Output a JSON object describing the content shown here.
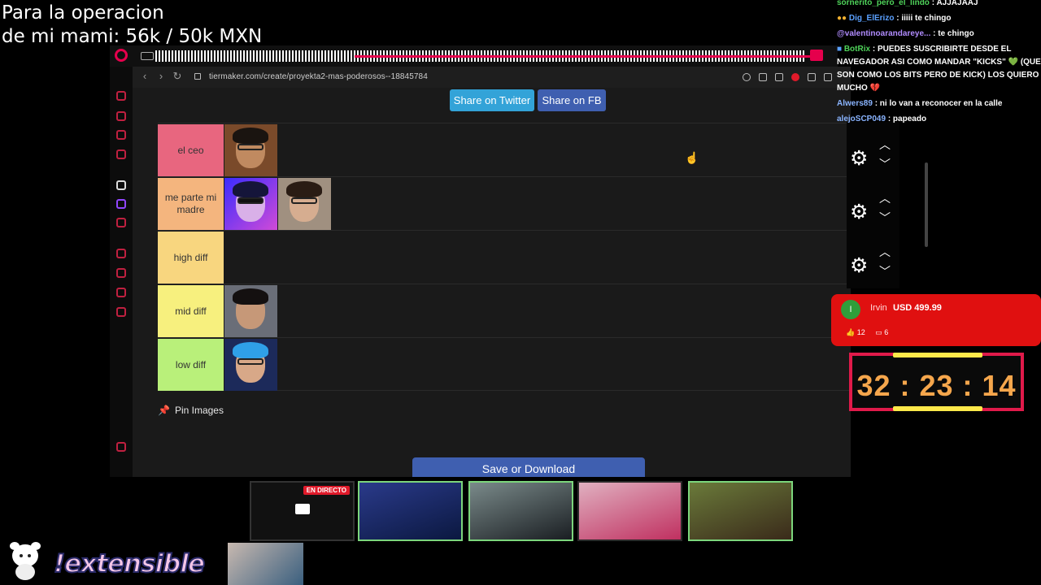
{
  "overlay": {
    "goal_line1": "Para la operacion",
    "goal_line2": "de mi mami: 56k / 50k MXN",
    "brand": "!extensible"
  },
  "browser": {
    "url": "tiermaker.com/create/proyekta2-mas-poderosos--18845784",
    "share_twitter": "Share on Twitter",
    "share_fb": "Share on FB",
    "pin_images": "Pin Images",
    "save_download": "Save or Download"
  },
  "tiers": [
    {
      "label": "el ceo",
      "color": "#e8667f",
      "items": 1
    },
    {
      "label": "me parte mi madre",
      "color": "#f4b57e",
      "items": 2
    },
    {
      "label": "high diff",
      "color": "#f8d67f",
      "items": 0
    },
    {
      "label": "mid diff",
      "color": "#f7f07e",
      "items": 1
    },
    {
      "label": "low diff",
      "color": "#b9f07a",
      "items": 1
    }
  ],
  "chat": [
    {
      "user": "sornerito_pero_el_lindo",
      "user_color": "#4fd35a",
      "text": " : AJJAJAAJ"
    },
    {
      "user": "Dig_ElErizo",
      "user_color": "#5aa0ff",
      "text": " : iiiii te chingo"
    },
    {
      "user": "@valentinoarandareye...",
      "user_color": "#b18cff",
      "text": " : te chingo"
    },
    {
      "user": "BotRix",
      "user_color": "#4fd35a",
      "text": " : PUEDES SUSCRIBIRTE DESDE EL NAVEGADOR ASI COMO MANDAR \"KICKS\" 💚 (QUE SON COMO LOS BITS PERO DE KICK) LOS QUIERO MUCHO 💔"
    },
    {
      "user": "Alwers89",
      "user_color": "#8ab4ff",
      "text": " : ni lo van a reconocer en la calle"
    },
    {
      "user": "alejoSCP049",
      "user_color": "#8ab4ff",
      "text": " : papeado"
    }
  ],
  "donation": {
    "avatar_letter": "I",
    "name": "Irvin",
    "amount": "USD 499.99",
    "likes": "12",
    "comments": "6"
  },
  "timer": {
    "value": "32 : 23 : 14"
  },
  "cams": {
    "live_badge": "EN DIRECTO"
  },
  "icons": {
    "gear": "gear-icon",
    "chevron_up": "chevron-up-icon",
    "chevron_down": "chevron-down-icon",
    "pin": "pin-icon"
  },
  "colors": {
    "accent_pink": "#e5004c",
    "twitter_blue": "#33a3d8",
    "fb_blue": "#3f5fb0",
    "donation_red": "#e01010",
    "timer_orange": "#f5a64c"
  }
}
